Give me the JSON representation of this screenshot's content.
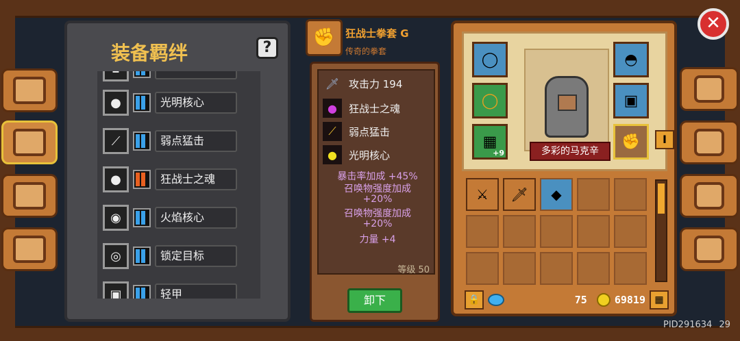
{
  "bond_panel": {
    "title": "装备羁绊",
    "help": "?",
    "items": [
      {
        "label": "光明核心",
        "icon": "light-core-icon",
        "bar_color": "#3aa0e8"
      },
      {
        "label": "弱点猛击",
        "icon": "weakness-strike-icon",
        "bar_color": "#3aa0e8"
      },
      {
        "label": "狂战士之魂",
        "icon": "berserker-soul-icon",
        "bar_color": "#e86020"
      },
      {
        "label": "火焰核心",
        "icon": "flame-core-icon",
        "bar_color": "#3aa0e8"
      },
      {
        "label": "锁定目标",
        "icon": "lock-target-icon",
        "bar_color": "#3aa0e8"
      },
      {
        "label": "轻甲",
        "icon": "light-armor-icon",
        "bar_color": "#3aa0e8"
      }
    ]
  },
  "item": {
    "name": "狂战士拳套 G",
    "subtitle": "传奇的拳套",
    "attack_label": "攻击力 194",
    "bonds": [
      "狂战士之魂",
      "弱点猛击",
      "光明核心"
    ],
    "bonuses": [
      "暴击率加成 +45%",
      "召唤物强度加成",
      "+20%",
      "召唤物强度加成",
      "+20%",
      "力量 +4"
    ],
    "level": "等级 50",
    "unequip_label": "卸下"
  },
  "equipment": {
    "character_name": "多彩的马克辛",
    "upgrade_badge": "+9",
    "gems": "75",
    "gold": "69819"
  },
  "footer": {
    "pid": "PID291634",
    "version": "29"
  }
}
